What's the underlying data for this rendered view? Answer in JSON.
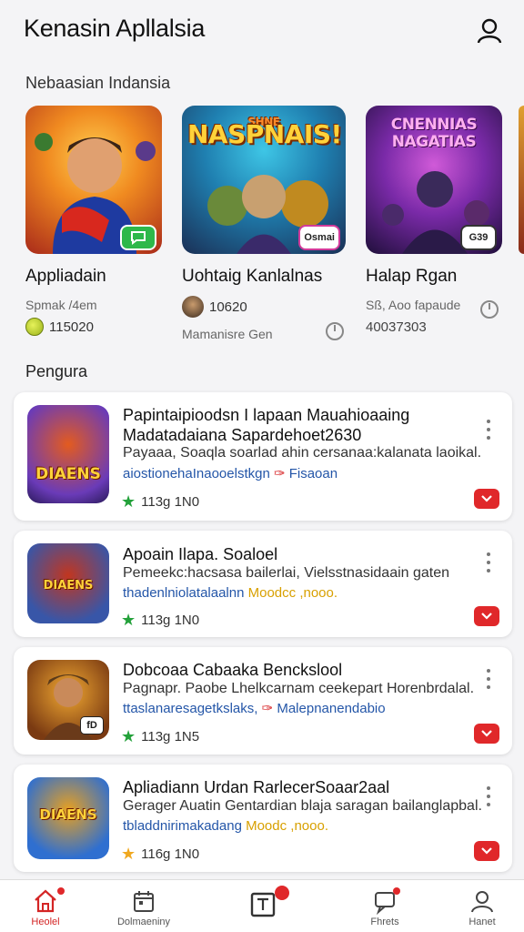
{
  "header": {
    "title": "Kenasin Apllalsia",
    "profile_icon": "user-icon"
  },
  "featured": {
    "section_label": "Nebaasian Indansia",
    "items": [
      {
        "name": "Appliadain",
        "sub": "Spmak /4em",
        "meta": "115020",
        "badge_icon": "chat-icon",
        "colors": [
          "#f4a020",
          "#b0251a"
        ]
      },
      {
        "name": "Uohtaig Kanlalnas",
        "art_text": "NASPNAIS!",
        "art_top": "SHNE",
        "meta": "10620",
        "footer": "Mamanisre Gen",
        "badge": "Osmai",
        "colors": [
          "#23a6c9",
          "#1b3f6d"
        ]
      },
      {
        "name": "Halap Rgan",
        "art_text": "CNENNIAS NAGATIAS",
        "meta": "Sß, Aoo fapaude",
        "footer": "40037303",
        "badge": "G39",
        "colors": [
          "#8d2fb0",
          "#2a1346"
        ]
      }
    ]
  },
  "list": {
    "section_label": "Pengura",
    "cards": [
      {
        "title": "Papintaipioodsn I lapaan Mauahioaaing Madatadaiana Sapardehoet2630",
        "desc": "Payaaa, Soaqla soarlad ahin cersanaa:kalanata laoikal.",
        "tags": "aiostionehaInaooelstkgn",
        "tag_extra": "Fisaoan",
        "rating": "113g 1N0",
        "star_color": "#23a13a",
        "icon_text": "DIAENS",
        "icon_colors": [
          "#6a3bb8",
          "#e35b1f"
        ]
      },
      {
        "title": "Apoain Ilapa. Soaloel",
        "desc": "Pemeekc:hacsasa bailerlai, Vielsstnasidaain gaten",
        "tags": "thadenlniolatalaalnn",
        "tag_extra": "Moodcc ,nooo.",
        "rating": "113g 1N0",
        "star_color": "#23a13a",
        "icon_text": "DIAENS",
        "icon_colors": [
          "#3856a8",
          "#c2361f"
        ]
      },
      {
        "title": "Dobcoaa Cabaaka Benckslool",
        "desc": "Pagnapr. Paobe Lhelkcarnam ceekepart Horenbrdalal.",
        "tags": "ttaslanaresagetkslaks,",
        "tag_extra": "Malepnanendabio",
        "rating": "113g 1N5",
        "star_color": "#23a13a",
        "icon_text": "",
        "icon_badge": "fD",
        "icon_colors": [
          "#f0a832",
          "#7a3a12"
        ]
      },
      {
        "title": "Apliadiann Urdan RarlecerSoaar2aal",
        "desc": "Gerager Auatin Gentardian blaja saragan bailanglapbal.",
        "tags": "tbladdnirimakadang",
        "tag_extra": "Moodc ,nooo.",
        "rating": "116g 1N0",
        "star_color": "#f0a820",
        "icon_text": "DIAENS",
        "icon_colors": [
          "#2f6fd0",
          "#e8a020"
        ]
      }
    ]
  },
  "bottom_nav": {
    "items": [
      {
        "label": "Heolel",
        "icon": "home-icon"
      },
      {
        "label": "Dolmaeniny",
        "icon": "calendar-icon"
      },
      {
        "label": "",
        "icon": "tablet-icon"
      },
      {
        "label": "Fhrets",
        "icon": "chat-icon"
      },
      {
        "label": "Hanet",
        "icon": "user-icon"
      }
    ]
  },
  "colors": {
    "accent": "#e0282a",
    "tag": "#2456a8",
    "background": "#f4f4f6"
  }
}
